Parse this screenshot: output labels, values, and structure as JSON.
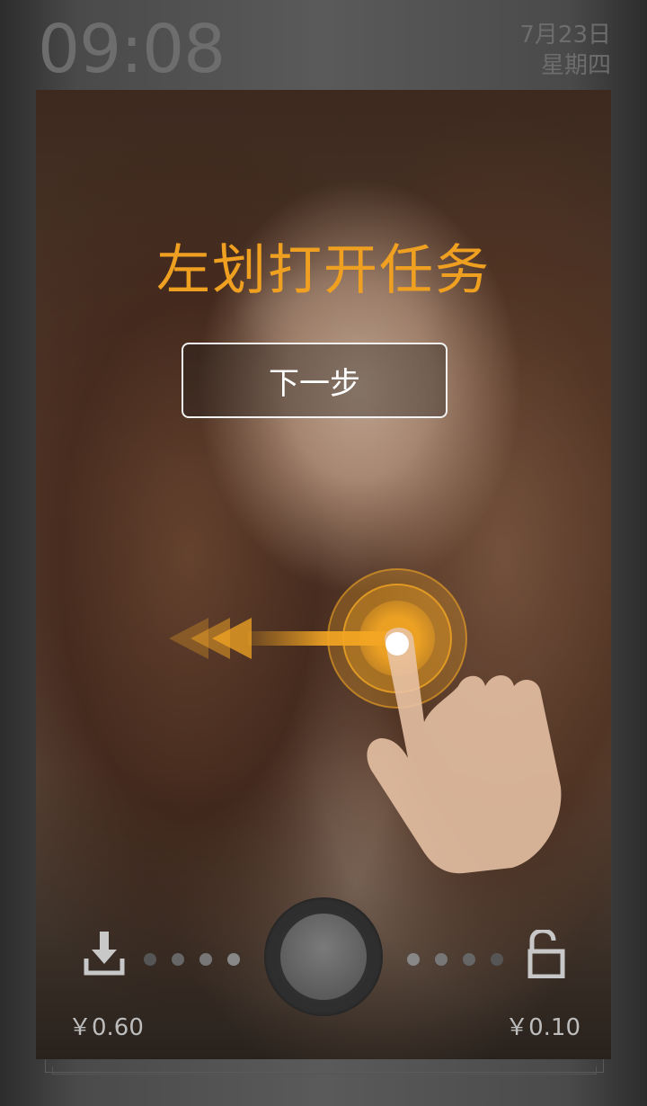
{
  "status": {
    "time": "09:08",
    "date": "7月23日",
    "weekday": "星期四"
  },
  "tutorial": {
    "title": "左划打开任务",
    "next_button": "下一步",
    "gesture_icon": "swipe-left-hand-icon"
  },
  "lockbar": {
    "left_icon": "download-icon",
    "right_icon": "unlock-icon",
    "left_reward": "￥0.60",
    "right_reward": "￥0.10"
  },
  "colors": {
    "accent": "#f0a020",
    "status_text": "#6d6d6d",
    "price_text": "#bdbdbd"
  }
}
